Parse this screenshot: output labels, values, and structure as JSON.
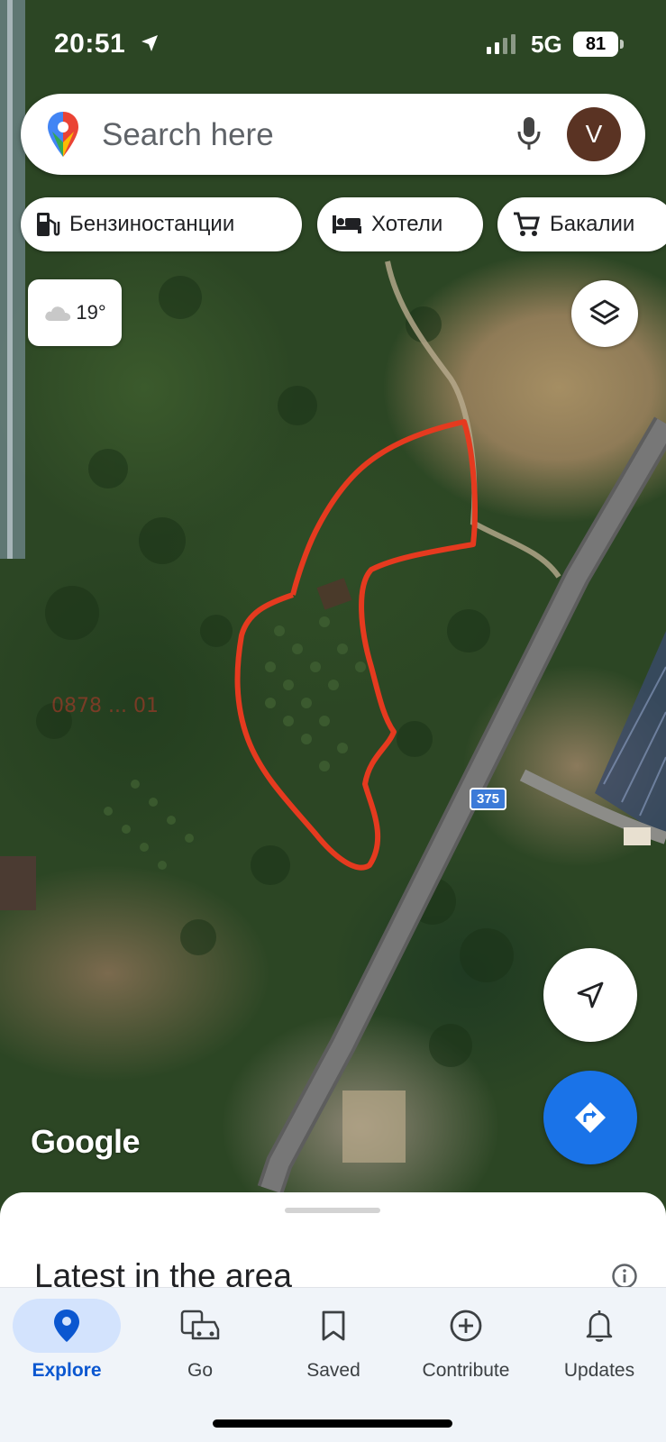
{
  "status_bar": {
    "time": "20:51",
    "network": "5G",
    "battery": "81"
  },
  "search": {
    "placeholder": "Search here",
    "avatar_initial": "V"
  },
  "chips": [
    {
      "label": "Бензиностанции",
      "icon": "gas-station-icon"
    },
    {
      "label": "Хотели",
      "icon": "hotel-bed-icon"
    },
    {
      "label": "Бакалии",
      "icon": "shopping-cart-icon"
    }
  ],
  "weather": {
    "temperature": "19°",
    "icon": "cloud-icon"
  },
  "map": {
    "route_shield": "375",
    "watermark": "0878 ... 01",
    "attribution": "Google",
    "colors": {
      "drawn_outline": "#e53a1f",
      "road": "#6b6b6b",
      "directions_button": "#1a73e8"
    }
  },
  "sheet": {
    "title": "Latest in the area"
  },
  "nav": {
    "items": [
      {
        "label": "Explore",
        "icon": "explore-pin-icon",
        "active": true
      },
      {
        "label": "Go",
        "icon": "car-icon",
        "active": false
      },
      {
        "label": "Saved",
        "icon": "bookmark-icon",
        "active": false
      },
      {
        "label": "Contribute",
        "icon": "add-circle-icon",
        "active": false
      },
      {
        "label": "Updates",
        "icon": "bell-icon",
        "active": false
      }
    ]
  }
}
